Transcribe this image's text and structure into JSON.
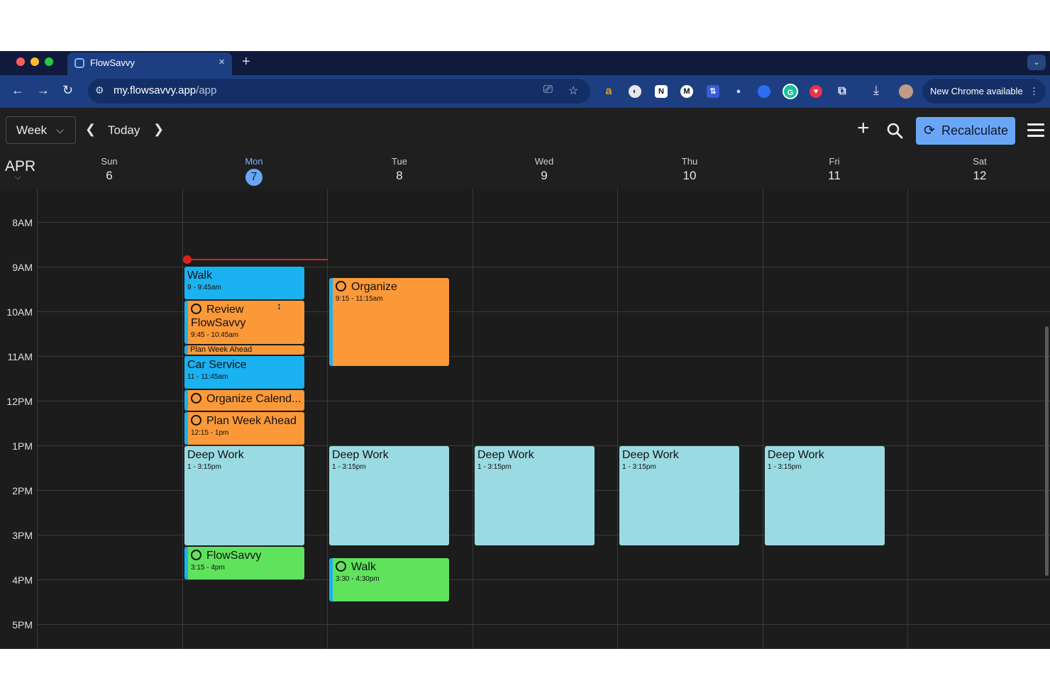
{
  "browser": {
    "tab_title": "FlowSavvy",
    "tab_close": "×",
    "new_tab": "+",
    "tab_search": "⌄",
    "url_host": "my.flowsavvy.app",
    "url_path": "/app",
    "update_label": "New Chrome available",
    "update_more": "⋮"
  },
  "toolbar": {
    "view_label": "Week",
    "today_label": "Today",
    "recalc_label": "Recalculate"
  },
  "header": {
    "month": "APR",
    "days": [
      {
        "dow": "Sun",
        "num": "6"
      },
      {
        "dow": "Mon",
        "num": "7"
      },
      {
        "dow": "Tue",
        "num": "8"
      },
      {
        "dow": "Wed",
        "num": "9"
      },
      {
        "dow": "Thu",
        "num": "10"
      },
      {
        "dow": "Fri",
        "num": "11"
      },
      {
        "dow": "Sat",
        "num": "12"
      }
    ]
  },
  "hours": [
    "8AM",
    "9AM",
    "10AM",
    "11AM",
    "12PM",
    "1PM",
    "2PM",
    "3PM",
    "4PM",
    "5PM"
  ],
  "events": {
    "mon_walk": {
      "title": "Walk",
      "time": "9 - 9:45am"
    },
    "mon_review": {
      "title": "Review FlowSavvy",
      "time": "9:45 - 10:45am"
    },
    "mon_plan_mini": {
      "title": "Plan Week Ahead"
    },
    "mon_car": {
      "title": "Car Service",
      "time": "11 - 11:45am"
    },
    "mon_organize": {
      "title": "Organize Calend..."
    },
    "mon_plan": {
      "title": "Plan Week Ahead",
      "time": "12:15 - 1pm"
    },
    "mon_deep": {
      "title": "Deep Work",
      "time": "1 - 3:15pm"
    },
    "mon_flowsavvy": {
      "title": "FlowSavvy",
      "time": "3:15 - 4pm"
    },
    "tue_organize": {
      "title": "Organize",
      "time": "9:15 - 11:15am"
    },
    "tue_deep": {
      "title": "Deep Work",
      "time": "1 - 3:15pm"
    },
    "tue_walk": {
      "title": "Walk",
      "time": "3:30 - 4:30pm"
    },
    "wed_deep": {
      "title": "Deep Work",
      "time": "1 - 3:15pm"
    },
    "thu_deep": {
      "title": "Deep Work",
      "time": "1 - 3:15pm"
    },
    "fri_deep": {
      "title": "Deep Work",
      "time": "1 - 3:15pm"
    }
  },
  "colors": {
    "accent": "#6aa6f8",
    "event_blue": "#1ab2f0",
    "event_orange": "#fb9939",
    "event_teal": "#9adbe3",
    "event_green": "#5fe35d",
    "now_line": "#e01e1e"
  },
  "icons": [
    "back-icon",
    "forward-icon",
    "reload-icon",
    "site-settings-icon",
    "install-icon",
    "bookmark-star-icon",
    "download-icon",
    "add-icon",
    "search-icon",
    "recalculate-icon",
    "menu-icon"
  ]
}
